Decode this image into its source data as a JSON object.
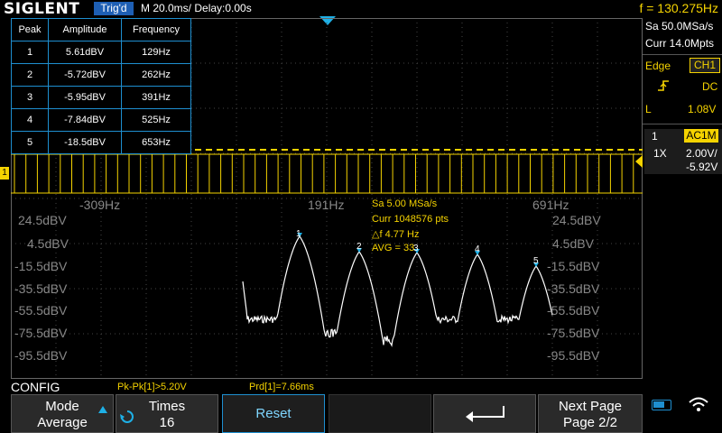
{
  "header": {
    "logo": "SIGLENT",
    "trigger_status": "Trig'd",
    "timebase": "M 20.0ms/ Delay:0.00s",
    "frequency": "f = 130.275Hz"
  },
  "acquisition": {
    "sample_rate": "Sa 50.0MSa/s",
    "memory": "Curr 14.0Mpts"
  },
  "trigger": {
    "type": "Edge",
    "source": "CH1",
    "coupling": "DC",
    "level_label": "L",
    "level": "1.08V"
  },
  "channel": {
    "number": "1",
    "coupling": "AC1M",
    "probe": "1X",
    "volts_per_div": "2.00V/",
    "offset": "-5.92V",
    "marker_label": "1"
  },
  "peak_table": {
    "headers": [
      "Peak",
      "Amplitude",
      "Frequency"
    ],
    "rows": [
      [
        "1",
        "5.61dBV",
        "129Hz"
      ],
      [
        "2",
        "-5.72dBV",
        "262Hz"
      ],
      [
        "3",
        "-5.95dBV",
        "391Hz"
      ],
      [
        "4",
        "-7.84dBV",
        "525Hz"
      ],
      [
        "5",
        "-18.5dBV",
        "653Hz"
      ]
    ]
  },
  "fft": {
    "x_labels": [
      "-309Hz",
      "191Hz",
      "691Hz"
    ],
    "y_labels_left": [
      "24.5dBV",
      "4.5dBV",
      "-15.5dBV",
      "-35.5dBV",
      "-55.5dBV",
      "-75.5dBV",
      "-95.5dBV"
    ],
    "y_labels_right": [
      "24.5dBV",
      "4.5dBV",
      "-15.5dBV",
      "-35.5dBV",
      "-55.5dBV",
      "-75.5dBV",
      "-95.5dBV"
    ],
    "info": {
      "sample_rate": "Sa 5.00 MSa/s",
      "points": "Curr 1048576 pts",
      "resolution": "△f 4.77 Hz",
      "average": "AVG = 33"
    },
    "peak_markers": [
      "1",
      "2",
      "3",
      "4",
      "5"
    ],
    "trace_color": "#ffffff"
  },
  "status": {
    "menu_name": "CONFIG",
    "measurement1": "Pk-Pk[1]>5.20V",
    "measurement2": "Prd[1]=7.66ms"
  },
  "softkeys": {
    "mode_label": "Mode",
    "mode_value": "Average",
    "times_label": "Times",
    "times_value": "16",
    "reset_label": "Reset",
    "next_page_label": "Next Page",
    "next_page_value": "Page 2/2"
  },
  "colors": {
    "channel_yellow": "#f5d300",
    "accent_blue": "#1e8fd0",
    "grid": "#444444"
  }
}
